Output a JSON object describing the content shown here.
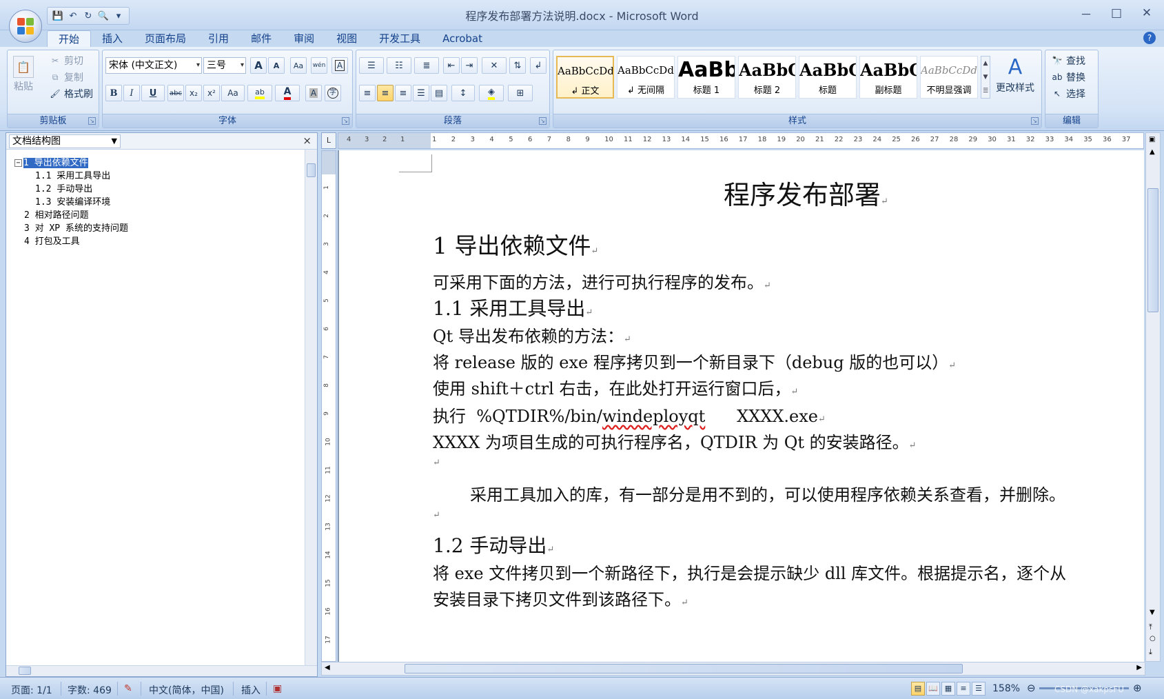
{
  "window": {
    "title": "程序发布部署方法说明.docx - Microsoft Word",
    "controls": [
      "－",
      "□",
      "✕"
    ]
  },
  "qat": {
    "save": "💾",
    "undo": "↶",
    "redo": "↻",
    "preview": "🔍",
    "customize": "▾"
  },
  "tabs": [
    "开始",
    "插入",
    "页面布局",
    "引用",
    "邮件",
    "审阅",
    "视图",
    "开发工具",
    "Acrobat"
  ],
  "ribbon": {
    "clipboard": {
      "label": "剪贴板",
      "paste": "粘贴",
      "cut": "剪切",
      "copy": "复制",
      "format_painter": "格式刷"
    },
    "font": {
      "label": "字体",
      "font_name": "宋体 (中文正文)",
      "font_size": "三号",
      "grow": "A",
      "shrink": "A",
      "clear": "Aa",
      "pinyin": "wén",
      "border": "A",
      "bold": "B",
      "italic": "I",
      "underline": "U",
      "strike": "abc",
      "sub": "x₂",
      "sup": "x²",
      "case": "Aa",
      "highlight": "ab",
      "color": "A",
      "shade": "A",
      "enclose": "字"
    },
    "paragraph": {
      "label": "段落"
    },
    "styles": {
      "label": "样式",
      "items": [
        {
          "sample": "AaBbCcDd",
          "name": "↲ 正文"
        },
        {
          "sample": "AaBbCcDd",
          "name": "↲ 无间隔"
        },
        {
          "sample": "AaBb",
          "name": "标题 1"
        },
        {
          "sample": "AaBbC",
          "name": "标题 2"
        },
        {
          "sample": "AaBbC",
          "name": "标题"
        },
        {
          "sample": "AaBbC",
          "name": "副标题"
        },
        {
          "sample": "AaBbCcDd",
          "name": "不明显强调"
        }
      ],
      "change_styles": "更改样式"
    },
    "editing": {
      "label": "编辑",
      "find": "查找",
      "replace": "替换",
      "select": "选择"
    }
  },
  "nav": {
    "view": "文档结构图",
    "close": "×",
    "items": [
      {
        "toggle": "−",
        "text": "1 导出依赖文件",
        "selected": true
      },
      {
        "toggle": "",
        "text": "1.1 采用工具导出",
        "selected": false
      },
      {
        "toggle": "",
        "text": "1.2 手动导出",
        "selected": false
      },
      {
        "toggle": "",
        "text": "1.3 安装编译环境",
        "selected": false
      },
      {
        "toggle": "",
        "text": "2 相对路径问题",
        "selected": false
      },
      {
        "toggle": "",
        "text": "3 对 XP 系统的支持问题",
        "selected": false
      },
      {
        "toggle": "",
        "text": "4 打包及工具",
        "selected": false
      }
    ]
  },
  "ruler": {
    "corner": "L",
    "left_numbers": [
      "4",
      "3",
      "2",
      "1"
    ],
    "numbers": [
      "1",
      "2",
      "3",
      "4",
      "5",
      "6",
      "7",
      "8",
      "9",
      "10",
      "11",
      "12",
      "13",
      "14",
      "15",
      "16",
      "17",
      "18",
      "19",
      "20",
      "21",
      "22",
      "23",
      "24",
      "25",
      "26",
      "27",
      "28",
      "29",
      "30",
      "31",
      "32",
      "33",
      "34",
      "35",
      "36",
      "37"
    ],
    "v_numbers": [
      "1",
      "2",
      "3",
      "4",
      "5",
      "6",
      "7",
      "8",
      "9",
      "10",
      "11",
      "12",
      "13",
      "14",
      "15",
      "16",
      "17"
    ]
  },
  "document": {
    "title": "程序发布部署",
    "mark": "↵",
    "h1_1": "1  导出依赖文件",
    "p1": "可采用下面的方法，进行可执行程序的发布。",
    "h2_1": "1.1  采用工具导出",
    "p2": "Qt 导出发布依赖的方法：",
    "p3": "将 release 版的 exe 程序拷贝到一个新目录下（debug 版的也可以）",
    "p4": "使用 shift＋ctrl  右击，在此处打开运行窗口后，",
    "p5a": "执行  %QTDIR%/bin/",
    "p5b": "windeployqt",
    "p5c": "      XXXX.exe",
    "p6": "XXXX 为项目生成的可执行程序名，QTDIR 为 Qt 的安装路径。",
    "p7": "采用工具加入的库，有一部分是用不到的，可以使用程序依赖关系查看，并删除。",
    "h2_2": "1.2  手动导出",
    "p8": "将 exe 文件拷贝到一个新路径下，执行是会提示缺少 dll 库文件。根据提示名，逐个从",
    "p9": "安装目录下拷贝文件到该路径下。"
  },
  "status": {
    "page": "页面: 1/1",
    "words": "字数: 469",
    "language": "中文(简体，中国)",
    "mode": "插入",
    "zoom": "158%",
    "watermark": "CSDN @xakpsFU"
  }
}
